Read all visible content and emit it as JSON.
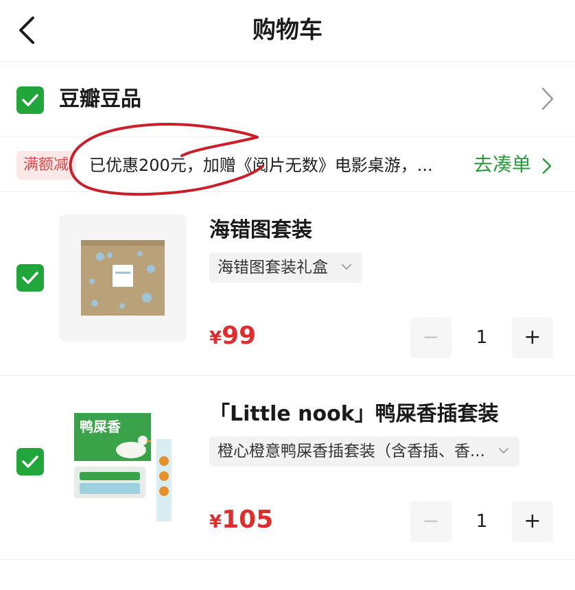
{
  "header": {
    "title": "购物车"
  },
  "shop": {
    "name": "豆瓣豆品",
    "checked": true
  },
  "promo": {
    "badge": "满额减",
    "text": "已优惠200元，加赠《阅片无数》电影桌游，...",
    "link": "去凑单",
    "annotation_color": "#c8202a"
  },
  "items": [
    {
      "checked": true,
      "title": "海错图套装",
      "variant": "海错图套装礼盒",
      "price_symbol": "¥",
      "price": "99",
      "quantity": "1",
      "minus_label": "−",
      "plus_label": "+"
    },
    {
      "checked": true,
      "title": "「Little nook」鸭屎香插套装",
      "variant": "橙心橙意鸭屎香插套装（含香插、香...",
      "price_symbol": "¥",
      "price": "105",
      "quantity": "1",
      "minus_label": "−",
      "plus_label": "+",
      "thumb_text": "鸭屎香"
    }
  ],
  "colors": {
    "accent_green": "#21a63b",
    "price_red": "#e02e2e",
    "link_green": "#2d9a3c"
  },
  "icons": {
    "back": "chevron-left-icon",
    "check": "check-icon",
    "shop_arrow": "chevron-right-icon",
    "variant_arrow": "chevron-down-icon"
  }
}
